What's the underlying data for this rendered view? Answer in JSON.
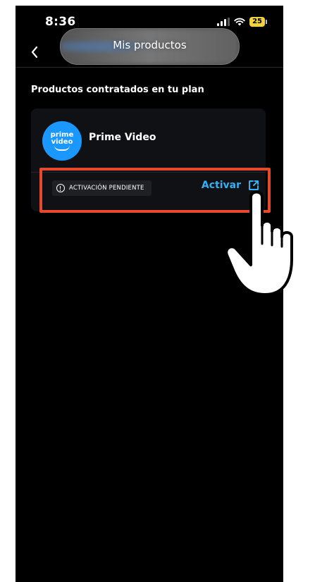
{
  "status_bar": {
    "time": "8:36",
    "battery": "25"
  },
  "header": {
    "title": "Mis productos"
  },
  "section": {
    "title": "Productos contratados en tu plan"
  },
  "product": {
    "logo_line1": "prime",
    "logo_line2": "video",
    "name": "Prime Video",
    "status": "ACTIVACIÓN PENDIENTE",
    "action_label": "Activar"
  },
  "colors": {
    "background": "#000000",
    "card": "#101114",
    "accent": "#2fb1f5",
    "highlight": "#e6492d",
    "logo": "#1a98ff"
  },
  "icons": {
    "back": "chevron-left-icon",
    "status": "alert-circle-icon",
    "action": "external-link-icon",
    "pointer": "hand-pointer-icon"
  }
}
